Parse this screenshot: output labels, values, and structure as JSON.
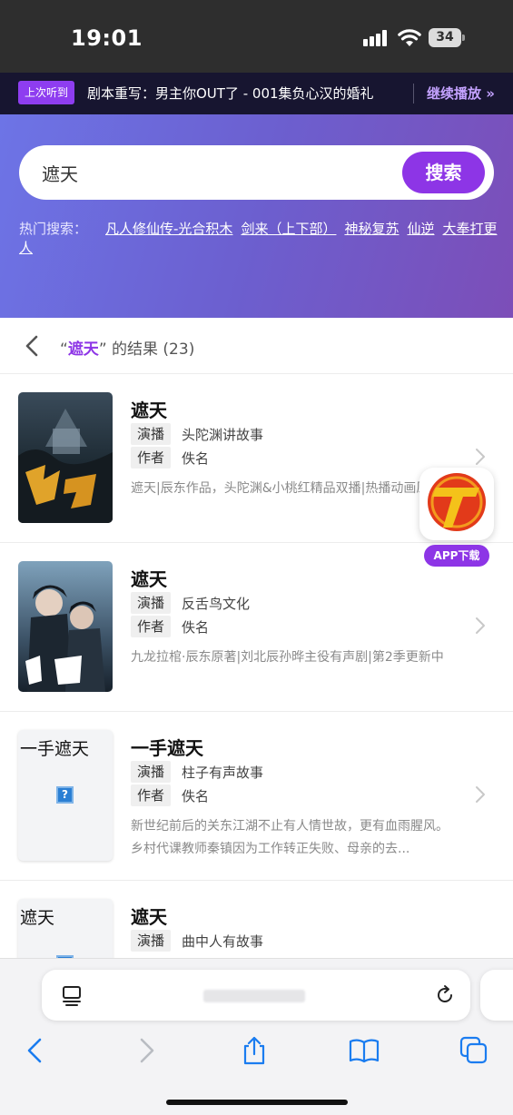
{
  "status_bar": {
    "time": "19:01",
    "battery": "34"
  },
  "recent": {
    "tag": "上次听到",
    "title": "剧本重写：男主你OUT了 - 001集负心汉的婚礼",
    "continue": "继续播放 »"
  },
  "search": {
    "value": "遮天",
    "button": "搜索",
    "hot_label": "热门搜索：",
    "hot_items": [
      "凡人修仙传-光合积木",
      "剑来（上下部）",
      "神秘复苏",
      "仙逆",
      "大奉打更人"
    ]
  },
  "results": {
    "open_quote": "“",
    "keyword": "遮天",
    "close_quote": "” 的结果 (23)"
  },
  "items": [
    {
      "title": "遮天",
      "performer_label": "演播",
      "performer": "头陀渊讲故事",
      "author_label": "作者",
      "author": "佚名",
      "desc": "遮天|辰东作品，头陀渊&小桃红精品双播|热播动画原著"
    },
    {
      "title": "遮天",
      "performer_label": "演播",
      "performer": "反舌鸟文化",
      "author_label": "作者",
      "author": "佚名",
      "desc": "九龙拉棺·辰东原著|刘北辰孙晔主役有声剧|第2季更新中"
    },
    {
      "title": "一手遮天",
      "cover_text": "一手遮天",
      "performer_label": "演播",
      "performer": "柱子有声故事",
      "author_label": "作者",
      "author": "佚名",
      "desc": "新世纪前后的关东江湖不止有人情世故，更有血雨腥风。乡村代课教师秦镇因为工作转正失败、母亲的去..."
    },
    {
      "title": "遮天",
      "cover_text": "遮天",
      "performer_label": "演播",
      "performer": "曲中人有故事"
    }
  ],
  "app_badge": {
    "label": "APP下载",
    "accent": "#8d35e6"
  },
  "colors": {
    "brand": "#8d35e6",
    "hero_start": "#6d74e6",
    "hero_end": "#7c4eb8",
    "link_blue": "#1a7cf0"
  }
}
